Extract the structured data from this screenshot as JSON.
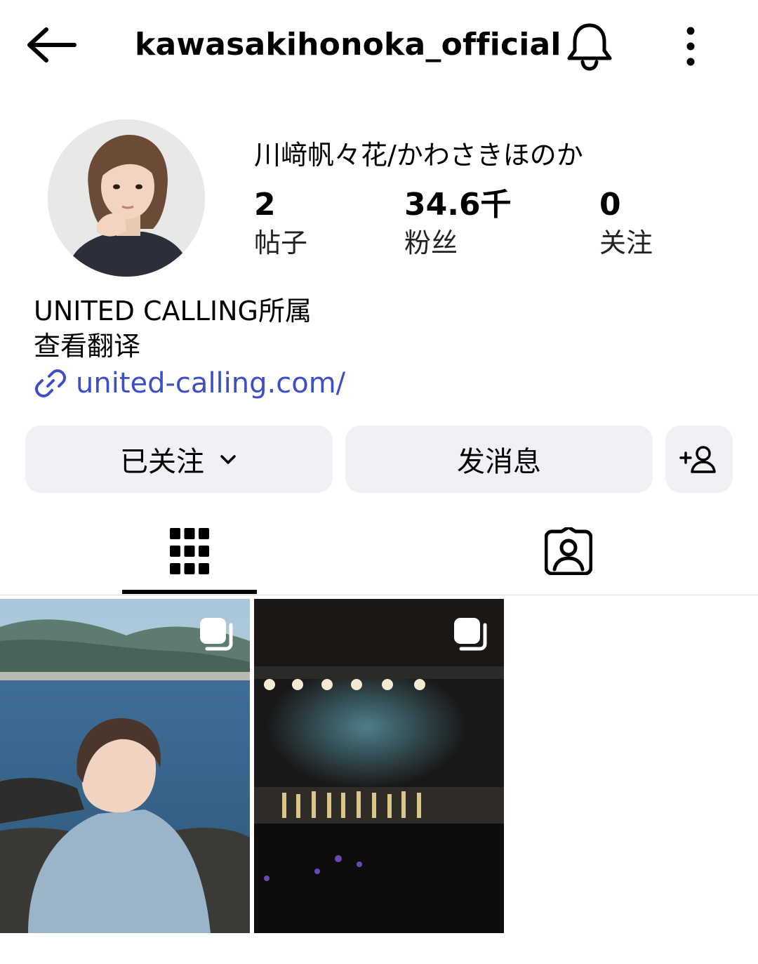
{
  "header": {
    "username": "kawasakihonoka_official",
    "back_icon": "arrow-left-icon",
    "bell_icon": "bell-icon",
    "more_icon": "more-vertical-icon"
  },
  "profile": {
    "display_name": "川﨑帆々花/かわさきほのか",
    "stats": [
      {
        "value": "2",
        "label": "帖子"
      },
      {
        "value": "34.6千",
        "label": "粉丝"
      },
      {
        "value": "0",
        "label": "关注"
      }
    ],
    "bio_line": "UNITED CALLING所属",
    "translate_label": "查看翻译",
    "link_text": "united-calling.com/",
    "link_color": "#3d4fc4"
  },
  "actions": {
    "following_label": "已关注",
    "message_label": "发消息",
    "add_user_icon": "add-user-icon",
    "button_bg": "#eff1f5"
  },
  "tabs": {
    "items": [
      {
        "name": "grid",
        "icon": "grid-icon",
        "active": true
      },
      {
        "name": "tagged",
        "icon": "tagged-person-icon",
        "active": false
      }
    ]
  },
  "posts": [
    {
      "type": "multi",
      "description": "lakeside-portrait"
    },
    {
      "type": "multi",
      "description": "concert-hall"
    }
  ]
}
